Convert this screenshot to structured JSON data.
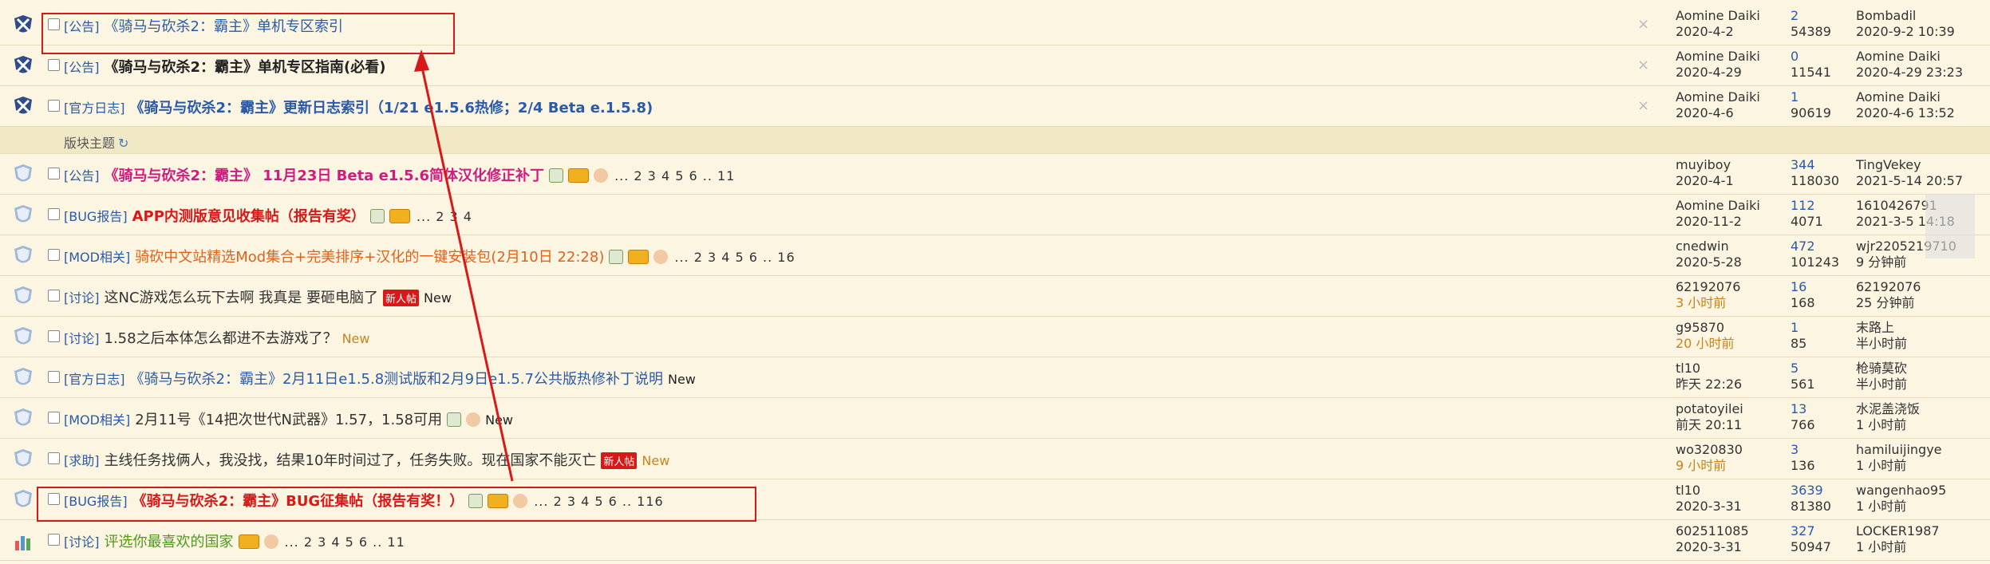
{
  "subheader": {
    "label": "版块主题",
    "icon": "refresh-icon"
  },
  "rows": [
    {
      "kind": "sticky",
      "icon": "global-sticky-icon",
      "category": "[公告]",
      "title": "《骑马与砍杀2：霸主》单机专区索引",
      "style": "blue",
      "badges": [],
      "pages": "",
      "newtag": "",
      "new": "",
      "closable": true,
      "author": "Aomine Daiki",
      "author_date": "2020-4-2",
      "replies": "2",
      "views": "54389",
      "last_user": "Bombadil",
      "last_time": "2020-9-2 10:39"
    },
    {
      "kind": "sticky",
      "icon": "global-sticky-icon",
      "category": "[公告]",
      "title": "《骑马与砍杀2：霸主》单机专区指南(必看)",
      "style": "dark",
      "badges": [],
      "pages": "",
      "newtag": "",
      "new": "",
      "closable": true,
      "author": "Aomine Daiki",
      "author_date": "2020-4-29",
      "replies": "0",
      "views": "11541",
      "last_user": "Aomine Daiki",
      "last_time": "2020-4-29 23:23"
    },
    {
      "kind": "sticky",
      "icon": "global-sticky-icon",
      "category": "[官方日志]",
      "title": "《骑马与砍杀2：霸主》更新日志索引（1/21 e1.5.6热修；2/4 Beta e.1.5.8)",
      "style": "blue bold",
      "badges": [],
      "pages": "",
      "newtag": "",
      "new": "",
      "closable": true,
      "author": "Aomine Daiki",
      "author_date": "2020-4-6",
      "replies": "1",
      "views": "90619",
      "last_user": "Aomine Daiki",
      "last_time": "2020-4-6 13:52"
    },
    {
      "kind": "topic",
      "icon": "forum-sticky-icon",
      "category": "[公告]",
      "title": "《骑马与砍杀2：霸主》 11月23日 Beta e1.5.6简体汉化修正补丁",
      "style": "pink",
      "badges": [
        "img",
        "hot",
        "hand"
      ],
      "pages": "... 2 3 4 5 6 .. 11",
      "newtag": "",
      "new": "",
      "closable": false,
      "author": "muyiboy",
      "author_date": "2020-4-1",
      "replies": "344",
      "views": "118030",
      "last_user": "TingVekey",
      "last_time": "2021-5-14 20:57"
    },
    {
      "kind": "topic",
      "icon": "forum-sticky-icon",
      "category": "[BUG报告]",
      "title": "APP内测版意见收集帖（报告有奖）",
      "style": "red",
      "badges": [
        "img",
        "hot"
      ],
      "pages": "... 2 3 4",
      "newtag": "",
      "new": "",
      "closable": false,
      "author": "Aomine Daiki",
      "author_date": "2020-11-2",
      "replies": "112",
      "views": "4071",
      "last_user": "1610426791",
      "last_time": "2021-3-5 14:18"
    },
    {
      "kind": "topic",
      "icon": "forum-sticky-icon",
      "category": "[MOD相关]",
      "title": "骑砍中文站精选Mod集合+完美排序+汉化的一键安装包(2月10日 22:28)",
      "style": "orange",
      "badges": [
        "img",
        "hot",
        "hand"
      ],
      "pages": "... 2 3 4 5 6 .. 16",
      "newtag": "",
      "new": "",
      "closable": false,
      "author": "cnedwin",
      "author_date": "2020-5-28",
      "replies": "472",
      "views": "101243",
      "last_user": "wjr2205219710",
      "last_time": "9 分钟前"
    },
    {
      "kind": "topic",
      "icon": "forum-sticky-icon",
      "category": "[讨论]",
      "title": "这NC游戏怎么玩下去啊 我真是 要砸电脑了",
      "style": "plain",
      "badges": [],
      "pages": "",
      "newtag": "新人帖",
      "new": "New",
      "newstyle": "black",
      "closable": false,
      "author": "62192076",
      "author_date": "3 小时前",
      "author_date_hl": true,
      "replies": "16",
      "views": "168",
      "last_user": "62192076",
      "last_time": "25 分钟前"
    },
    {
      "kind": "topic",
      "icon": "forum-sticky-icon",
      "category": "[讨论]",
      "title": "1.58之后本体怎么都进不去游戏了？",
      "style": "plain",
      "badges": [],
      "pages": "",
      "newtag": "",
      "new": "New",
      "newstyle": "gold",
      "closable": false,
      "author": "g95870",
      "author_date": "20 小时前",
      "author_date_hl": true,
      "replies": "1",
      "views": "85",
      "last_user": "末路上",
      "last_time": "半小时前"
    },
    {
      "kind": "topic",
      "icon": "forum-sticky-icon",
      "category": "[官方日志]",
      "title": "《骑马与砍杀2：霸主》2月11日e1.5.8测试版和2月9日e1.5.7公共版热修补丁说明",
      "style": "blue",
      "badges": [],
      "pages": "",
      "newtag": "",
      "new": "New",
      "newstyle": "black",
      "closable": false,
      "author": "tl10",
      "author_date": "昨天 22:26",
      "replies": "5",
      "views": "561",
      "last_user": "枪骑莫砍",
      "last_time": "半小时前"
    },
    {
      "kind": "topic",
      "icon": "forum-sticky-icon",
      "category": "[MOD相关]",
      "title": "2月11号《14把次世代N武器》1.57，1.58可用",
      "style": "plain",
      "badges": [
        "img",
        "hand"
      ],
      "pages": "",
      "newtag": "",
      "new": "New",
      "newstyle": "black",
      "closable": false,
      "author": "potatoyilei",
      "author_date": "前天 20:11",
      "replies": "13",
      "views": "766",
      "last_user": "水泥盖浇饭",
      "last_time": "1 小时前"
    },
    {
      "kind": "topic",
      "icon": "forum-sticky-icon",
      "category": "[求助]",
      "title": "主线任务找俩人，我没找，结果10年时间过了，任务失败。现在国家不能灭亡",
      "style": "plain",
      "badges": [],
      "pages": "",
      "newtag": "新人帖",
      "new": "New",
      "newstyle": "gold",
      "closable": false,
      "author": "wo320830",
      "author_date": "9 小时前",
      "author_date_hl": true,
      "replies": "3",
      "views": "136",
      "last_user": "hamiluijingye",
      "last_time": "1 小时前"
    },
    {
      "kind": "topic",
      "icon": "forum-sticky-icon",
      "category": "[BUG报告]",
      "title": "《骑马与砍杀2：霸主》BUG征集帖（报告有奖！）",
      "style": "red",
      "badges": [
        "img",
        "hot",
        "hand"
      ],
      "pages": "... 2 3 4 5 6 .. 116",
      "newtag": "",
      "new": "",
      "closable": false,
      "author": "tl10",
      "author_date": "2020-3-31",
      "replies": "3639",
      "views": "81380",
      "last_user": "wangenhao95",
      "last_time": "1 小时前"
    },
    {
      "kind": "topic",
      "icon": "poll-icon",
      "category": "[讨论]",
      "title": "评选你最喜欢的国家",
      "style": "green",
      "badges": [
        "hot",
        "hand"
      ],
      "pages": "... 2 3 4 5 6 .. 11",
      "newtag": "",
      "new": "",
      "closable": false,
      "author": "602511085",
      "author_date": "2020-3-31",
      "replies": "327",
      "views": "50947",
      "last_user": "LOCKER1987",
      "last_time": "1 小时前"
    }
  ],
  "colors": {
    "annotation_red": "#d8191a",
    "link_blue": "#2a5aa8",
    "background": "#fbf5e2"
  }
}
